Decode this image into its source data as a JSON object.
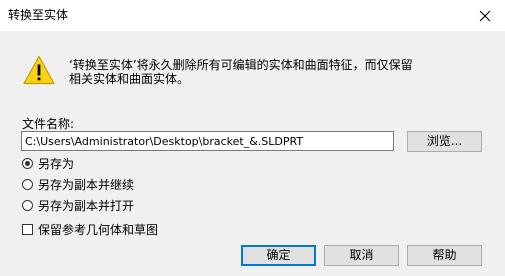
{
  "window": {
    "title": "转换至实体",
    "close_glyph": "✕"
  },
  "message": {
    "icon": "warning-icon",
    "line1": "‘转换至实体’将永久删除所有可编辑的实体和曲面特征，而仅保留",
    "line2": "相关实体和曲面实体。"
  },
  "file": {
    "label": "文件名称:",
    "value": "C:\\Users\\Administrator\\Desktop\\bracket_&.SLDPRT",
    "browse_label": "浏览..."
  },
  "options": [
    {
      "label": "另存为",
      "checked": true
    },
    {
      "label": "另存为副本并继续",
      "checked": false
    },
    {
      "label": "另存为副本并打开",
      "checked": false
    }
  ],
  "keep_reference": {
    "label": "保留参考几何体和草图",
    "checked": false
  },
  "buttons": {
    "ok": "确定",
    "cancel": "取消",
    "help": "帮助"
  }
}
